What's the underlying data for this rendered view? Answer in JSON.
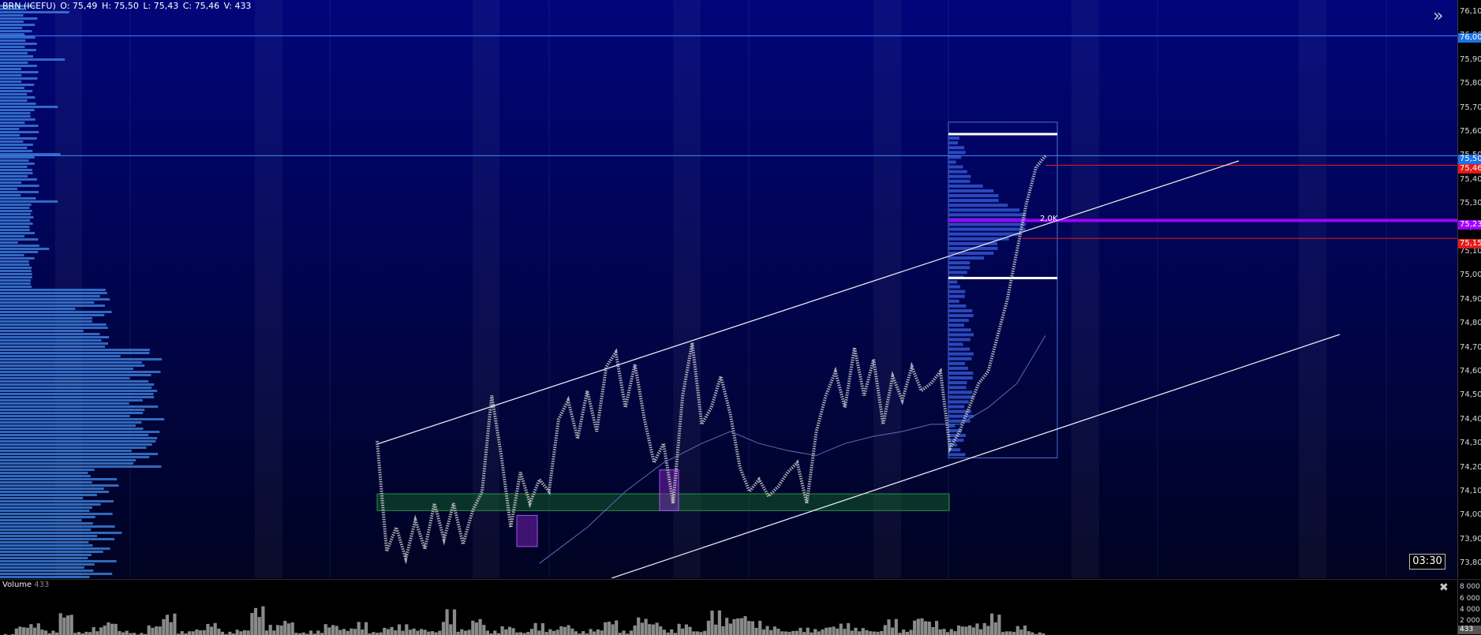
{
  "header": {
    "symbol": "BRN (ICEFU)",
    "open": "O: 75,49",
    "high": "H: 75,50",
    "low": "L: 75,43",
    "close": "C: 75,46",
    "volume": "V: 433"
  },
  "volume_pane": {
    "title": "Volume",
    "value": "433",
    "ticks": [
      "8 000",
      "6 000",
      "4 000",
      "2 000"
    ],
    "current_tag": "433"
  },
  "countdown": "03:30",
  "price_tags": {
    "level_76": "76,00",
    "level_7550": "75,50",
    "last": "75,46",
    "poc": "75,23",
    "red_level": "75,15"
  },
  "vp_label": "2,0K",
  "colors": {
    "bg_top": "#01057a",
    "bg_bottom": "#000321",
    "tag_blue": "#1a73e8",
    "tag_red": "#e31a1a",
    "poc": "#a100ff",
    "profile": "#3050c8",
    "zone_green": "#0b3a12"
  },
  "icons": {
    "expand": "double-chevron-right-icon",
    "close": "close-icon"
  },
  "chart_data": {
    "type": "line",
    "title": "",
    "xlabel": "",
    "ylabel": "",
    "ylim": [
      73.8,
      76.1
    ],
    "y_ticks": [
      "76,10",
      "76,00",
      "75,90",
      "75,80",
      "75,70",
      "75,60",
      "75,50",
      "75,40",
      "75,30",
      "75,20",
      "75,10",
      "75,00",
      "74,90",
      "74,80",
      "74,70",
      "74,60",
      "74,50",
      "74,40",
      "74,30",
      "74,20",
      "74,10",
      "74,00",
      "73,90",
      "73,80"
    ],
    "y_tick_values": [
      76.1,
      76.0,
      75.9,
      75.8,
      75.7,
      75.6,
      75.5,
      75.4,
      75.3,
      75.2,
      75.1,
      75.0,
      74.9,
      74.8,
      74.7,
      74.6,
      74.5,
      74.4,
      74.3,
      74.2,
      74.1,
      74.0,
      73.9,
      73.8
    ],
    "x_range": [
      0,
      100
    ],
    "series": [
      {
        "x": [
          0,
          1,
          2,
          3,
          4,
          5,
          6,
          7,
          8,
          9,
          10,
          11,
          12,
          13,
          14,
          15,
          16,
          17,
          18,
          19,
          20,
          21,
          22,
          23,
          24,
          25,
          26,
          27,
          28,
          29,
          30,
          31,
          32,
          33,
          34,
          35,
          36,
          37,
          38,
          39,
          40,
          41,
          42,
          43,
          44,
          45,
          46,
          47,
          48,
          49,
          50,
          51,
          52,
          53,
          54,
          55,
          56,
          57,
          58,
          59,
          60,
          61,
          62,
          63,
          64,
          65,
          66,
          67,
          68,
          69,
          70
        ],
        "values": [
          74.31,
          73.85,
          73.95,
          73.82,
          73.98,
          73.86,
          74.05,
          73.9,
          74.05,
          73.88,
          74.02,
          74.1,
          74.5,
          74.25,
          73.95,
          74.18,
          74.05,
          74.15,
          74.1,
          74.4,
          74.48,
          74.32,
          74.52,
          74.35,
          74.62,
          74.68,
          74.45,
          74.63,
          74.4,
          74.22,
          74.3,
          74.05,
          74.5,
          74.72,
          74.38,
          74.45,
          74.58,
          74.42,
          74.2,
          74.1,
          74.15,
          74.08,
          74.12,
          74.18,
          74.22,
          74.05,
          74.35,
          74.5,
          74.6,
          74.45,
          74.7,
          74.5,
          74.65,
          74.38,
          74.58,
          74.48,
          74.62,
          74.52,
          74.55,
          74.6,
          74.28,
          74.35,
          74.45,
          74.55,
          74.6,
          74.75,
          74.9,
          75.1,
          75.3,
          75.45,
          75.5
        ]
      },
      {
        "x": [
          17,
          22,
          26,
          30,
          34,
          37,
          40,
          43,
          46,
          49,
          52,
          55,
          58,
          61,
          64,
          67,
          70
        ],
        "values": [
          73.8,
          73.95,
          74.1,
          74.22,
          74.3,
          74.35,
          74.3,
          74.27,
          74.25,
          74.3,
          74.33,
          74.35,
          74.38,
          74.38,
          74.45,
          74.55,
          74.75
        ]
      }
    ],
    "volume": {
      "ylim": [
        0,
        9000
      ],
      "values": [
        300,
        1800,
        2200,
        900,
        4200,
        700,
        1500,
        2600,
        900,
        500,
        1900,
        3900,
        800,
        1200,
        2300,
        700,
        1100,
        5200,
        1900,
        2800,
        600,
        900,
        2100,
        1300,
        2400,
        700,
        1600,
        2000,
        1300,
        900,
        4600,
        1200,
        3100,
        900,
        1700,
        700,
        2200,
        1200,
        2000,
        800,
        1200,
        2800,
        900,
        3300,
        2500,
        1100,
        2100,
        900,
        4400,
        3200,
        3800,
        2600,
        1700,
        900,
        1400,
        1200,
        1800,
        2200,
        1400,
        900,
        2900,
        1100,
        3500,
        2600,
        1200,
        2000,
        2200,
        3900,
        900,
        1800,
        600
      ]
    }
  }
}
